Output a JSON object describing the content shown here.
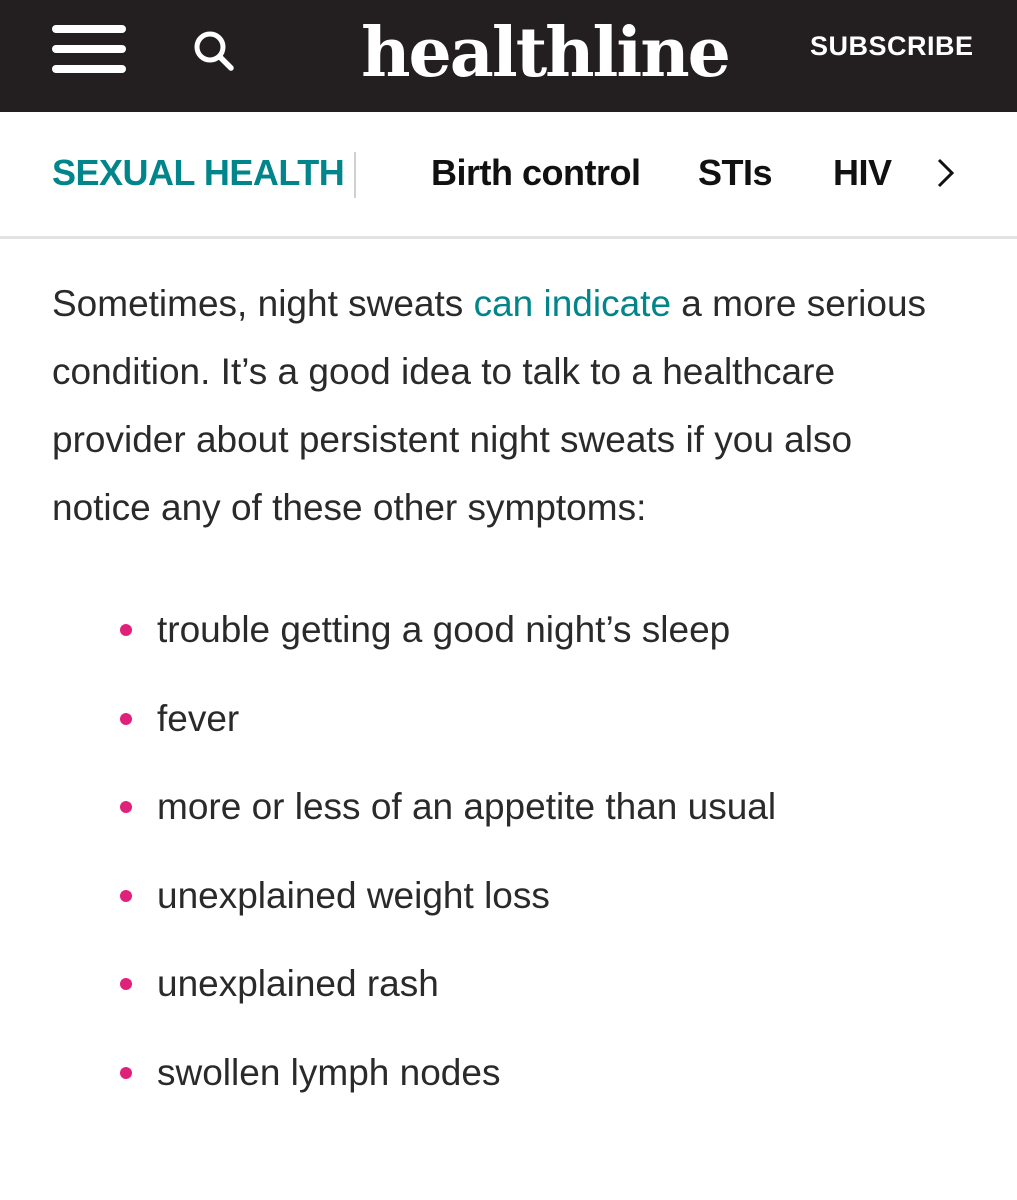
{
  "header": {
    "logo": "healthline",
    "subscribe_label": "SUBSCRIBE",
    "menu_icon": "hamburger-menu-icon",
    "search_icon": "search-icon",
    "background_color": "#231f20"
  },
  "subnav": {
    "section_title": "SEXUAL HEALTH",
    "section_color": "#00858a",
    "links": [
      "Birth control",
      "STIs",
      "HIV"
    ],
    "next_icon": "chevron-right-icon"
  },
  "article": {
    "intro_before_link": "Sometimes, night sweats ",
    "intro_link": "can indicate",
    "intro_after_link": " a more serious condition. It’s a good idea to talk to a healthcare provider about persistent night sweats if you also notice any of these other symptoms:",
    "link_color": "#00858a",
    "bullet_color": "#e0217a",
    "symptoms": [
      "trouble getting a good night’s sleep",
      "fever",
      "more or less of an appetite than usual",
      "unexplained weight loss",
      "unexplained rash",
      "swollen lymph nodes"
    ]
  }
}
